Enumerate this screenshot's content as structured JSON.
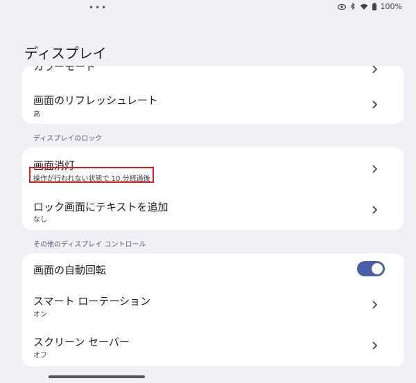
{
  "status": {
    "dots": "•••",
    "battery": "100%"
  },
  "title": "ディスプレイ",
  "card1": {
    "item_color_mode": {
      "title": "カラーモード"
    },
    "item_refresh": {
      "title": "画面のリフレッシュレート",
      "subtitle": "高"
    }
  },
  "section_lock": "ディスプレイのロック",
  "card2": {
    "item_screen_timeout": {
      "title": "画面消灯",
      "subtitle": "操作が行われない状態で 10 分経過後"
    },
    "item_lock_text": {
      "title": "ロック画面にテキストを追加",
      "subtitle": "なし"
    }
  },
  "section_other": "その他のディスプレイ コントロール",
  "card3": {
    "item_auto_rotate": {
      "title": "画面の自動回転",
      "enabled": true
    },
    "item_smart_rotation": {
      "title": "スマート ローテーション",
      "subtitle": "オン"
    },
    "item_screen_saver": {
      "title": "スクリーン セーバー",
      "subtitle": "オフ"
    }
  },
  "colors": {
    "background": "#f1f0f6",
    "toggle_on": "#4a5da8",
    "highlight": "#e01a1a"
  },
  "icons": [
    "more-dots-icon",
    "eye-icon",
    "bluetooth-icon",
    "wifi-icon",
    "battery-icon",
    "chevron-right-icon"
  ]
}
